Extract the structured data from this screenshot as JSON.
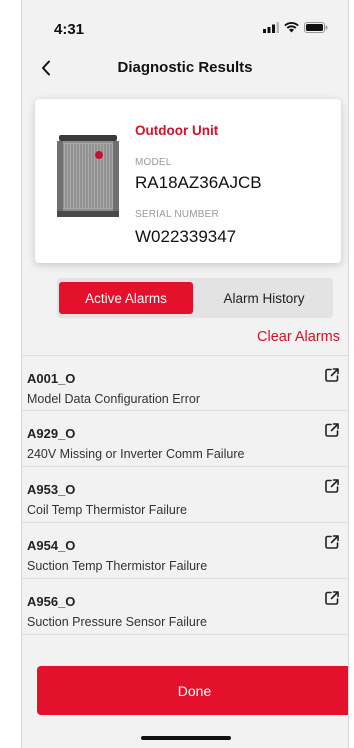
{
  "status_bar": {
    "time": "4:31"
  },
  "header": {
    "title": "Diagnostic Results",
    "back_icon": "chevron-left-icon"
  },
  "unit_card": {
    "name": "Outdoor Unit",
    "model_label": "MODEL",
    "model_value": "RA18AZ36AJCB",
    "serial_label": "SERIAL NUMBER",
    "serial_value": "W022339347"
  },
  "tabs": {
    "active": "Active Alarms",
    "inactive": "Alarm History"
  },
  "clear_alarms": "Clear Alarms",
  "alarms": [
    {
      "code": "A001_O",
      "description": "Model Data Configuration Error"
    },
    {
      "code": "A929_O",
      "description": "240V Missing or Inverter Comm Failure"
    },
    {
      "code": "A953_O",
      "description": "Coil Temp Thermistor Failure"
    },
    {
      "code": "A954_O",
      "description": "Suction Temp Thermistor Failure"
    },
    {
      "code": "A956_O",
      "description": "Suction Pressure Sensor Failure"
    }
  ],
  "done_label": "Done",
  "colors": {
    "accent": "#e3112c",
    "background": "#f2f2f2"
  }
}
